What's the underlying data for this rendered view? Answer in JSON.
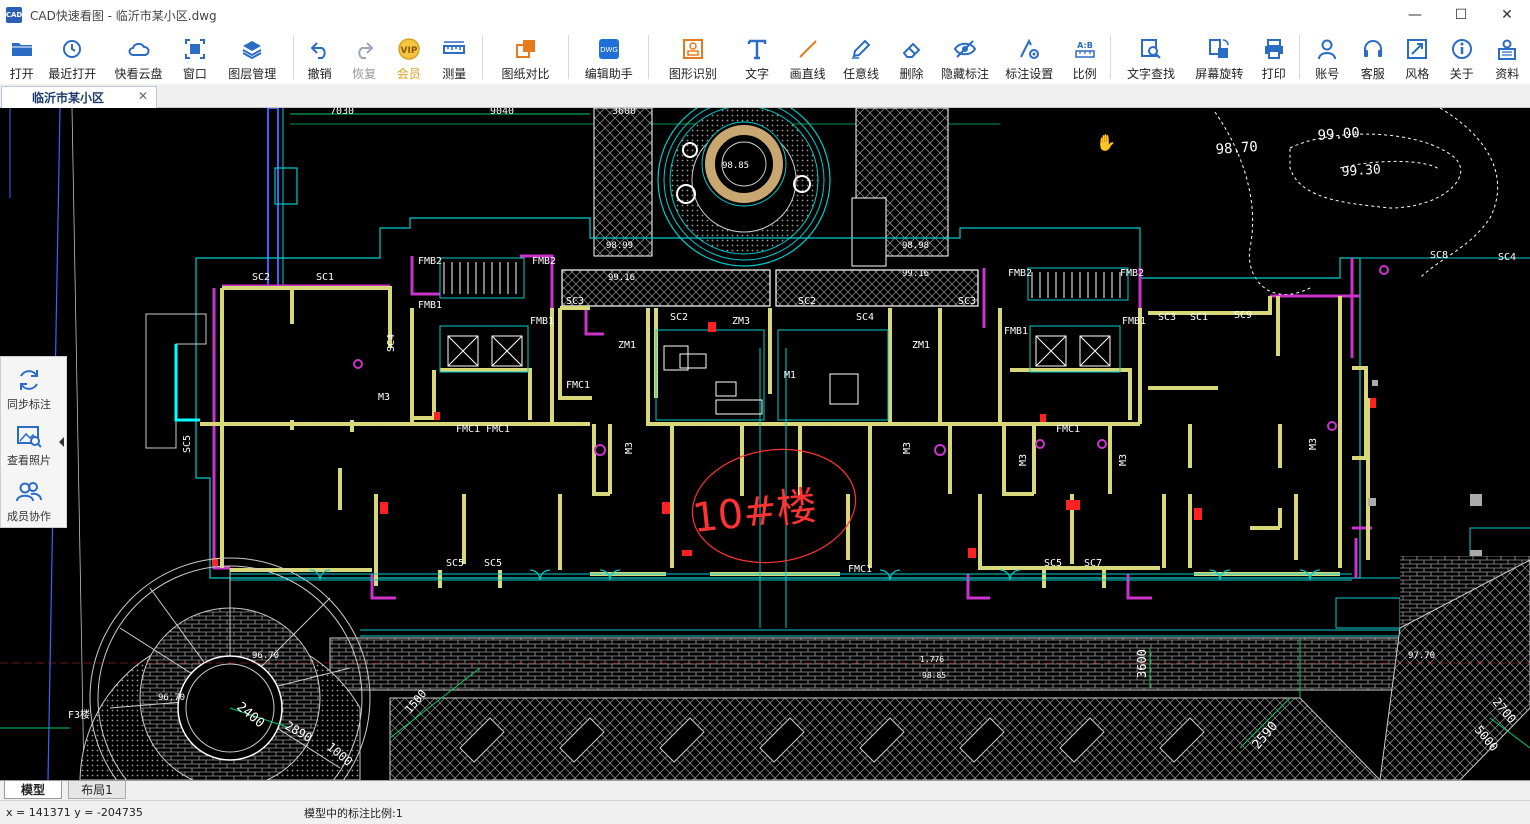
{
  "window": {
    "app_icon_text": "CAD",
    "title": "CAD快速看图 - 临沂市某小区.dwg",
    "controls": {
      "minimize": "—",
      "maximize": "☐",
      "close": "✕"
    }
  },
  "toolbar": {
    "groups": [
      [
        {
          "key": "open",
          "label": "打开",
          "icon": "folder-icon",
          "color": "#2b6cc4"
        },
        {
          "key": "recent",
          "label": "最近打开",
          "icon": "clock-icon",
          "color": "#2b6cc4"
        },
        {
          "key": "cloud",
          "label": "快看云盘",
          "icon": "cloud-icon",
          "color": "#2b6cc4"
        },
        {
          "key": "window",
          "label": "窗口",
          "icon": "window-icon",
          "color": "#2b6cc4"
        },
        {
          "key": "layers",
          "label": "图层管理",
          "icon": "layers-icon",
          "color": "#2b6cc4"
        }
      ],
      [
        {
          "key": "undo",
          "label": "撤销",
          "icon": "undo-icon",
          "color": "#2b6cc4"
        },
        {
          "key": "redo",
          "label": "恢复",
          "icon": "redo-icon",
          "color": "#9aa6b5",
          "disabled": true
        },
        {
          "key": "vip",
          "label": "会员",
          "icon": "vip-icon",
          "color": "#d8a21e",
          "label_color": "#d8a21e"
        },
        {
          "key": "measure",
          "label": "测量",
          "icon": "ruler-icon",
          "color": "#2b6cc4"
        }
      ],
      [
        {
          "key": "compare",
          "label": "图纸对比",
          "icon": "compare-icon",
          "color": "#e57b1e"
        }
      ],
      [
        {
          "key": "edit",
          "label": "编辑助手",
          "icon": "edit-assistant-icon",
          "color": "#1f6fd6"
        }
      ],
      [
        {
          "key": "shape",
          "label": "图形识别",
          "icon": "shape-recognize-icon",
          "color": "#e57b1e"
        },
        {
          "key": "text",
          "label": "文字",
          "icon": "text-icon",
          "color": "#2b6cc4"
        },
        {
          "key": "line",
          "label": "画直线",
          "icon": "line-icon",
          "color": "#e57b1e"
        },
        {
          "key": "freeline",
          "label": "任意线",
          "icon": "pencil-icon",
          "color": "#2b6cc4"
        },
        {
          "key": "erase",
          "label": "删除",
          "icon": "eraser-icon",
          "color": "#2b6cc4"
        },
        {
          "key": "hide",
          "label": "隐藏标注",
          "icon": "eye-hide-icon",
          "color": "#2b6cc4"
        },
        {
          "key": "annotset",
          "label": "标注设置",
          "icon": "annotation-settings-icon",
          "color": "#2b6cc4"
        },
        {
          "key": "scale",
          "label": "比例",
          "icon": "scale-icon",
          "color": "#2b6cc4"
        }
      ],
      [
        {
          "key": "find",
          "label": "文字查找",
          "icon": "text-search-icon",
          "color": "#2b6cc4"
        },
        {
          "key": "rotate",
          "label": "屏幕旋转",
          "icon": "rotate-screen-icon",
          "color": "#2b6cc4"
        },
        {
          "key": "print",
          "label": "打印",
          "icon": "printer-icon",
          "color": "#2b6cc4"
        }
      ],
      [
        {
          "key": "account",
          "label": "账号",
          "icon": "user-icon",
          "color": "#2b6cc4"
        },
        {
          "key": "service",
          "label": "客服",
          "icon": "headset-icon",
          "color": "#2b6cc4"
        },
        {
          "key": "style",
          "label": "风格",
          "icon": "style-icon",
          "color": "#2b6cc4"
        },
        {
          "key": "about",
          "label": "关于",
          "icon": "info-icon",
          "color": "#2b6cc4"
        },
        {
          "key": "docs",
          "label": "资料",
          "icon": "docs-icon",
          "color": "#2b6cc4"
        }
      ]
    ]
  },
  "document_tab": {
    "label": "临沂市某小区",
    "close": "✕"
  },
  "side_panel": {
    "items": [
      {
        "key": "sync",
        "label": "同步标注",
        "icon": "sync-icon"
      },
      {
        "key": "photos",
        "label": "查看照片",
        "icon": "photo-search-icon"
      },
      {
        "key": "members",
        "label": "成员协作",
        "icon": "members-icon"
      }
    ]
  },
  "drawing": {
    "dimensions_top": [
      "7030",
      "9040",
      "3600"
    ],
    "elevations": [
      "98.70",
      "99.00",
      "99.30",
      "98.85",
      "98.99",
      "99.16",
      "98.98",
      "99.16",
      "96.70",
      "96.70",
      "97.70",
      "98.85"
    ],
    "window_labels": [
      "SC2",
      "SC1",
      "SC3",
      "SC2",
      "SC3",
      "SC2",
      "SC4",
      "SC3",
      "SC1",
      "SC9",
      "SC8",
      "SC4",
      "SC4",
      "SC5",
      "SC5",
      "SC5",
      "SC5",
      "SC7"
    ],
    "door_labels": [
      "FMB1",
      "FMB1",
      "FMB2",
      "FMB2",
      "FMB1",
      "FMB1",
      "FMB2",
      "FMB2",
      "ZM1",
      "ZM3",
      "ZM1",
      "M1",
      "M3",
      "M3",
      "M3",
      "M3",
      "M3",
      "M3",
      "FMC1",
      "FMC1",
      "FMC1",
      "FMC1",
      "FMC1"
    ],
    "dimensions_bottom": [
      "2400",
      "2890",
      "1000",
      "1500",
      "3600",
      "2590",
      "2700",
      "5000",
      "1.776"
    ],
    "building_markup": "10#楼",
    "small_label": "F3楼"
  },
  "layout_tabs": {
    "model": "模型",
    "layout1": "布局1"
  },
  "status": {
    "coords": "x = 141371  y = -204735",
    "scale": "模型中的标注比例:1"
  }
}
